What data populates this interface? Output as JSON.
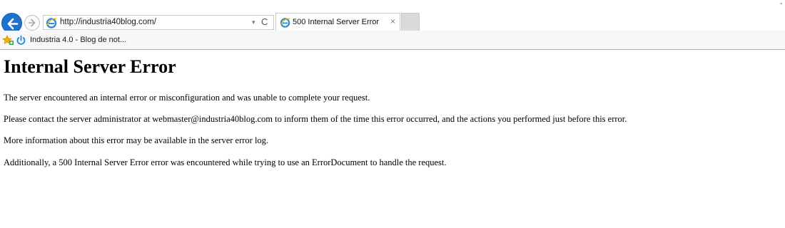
{
  "browser": {
    "address_bar": {
      "url": "http://industria40blog.com/"
    },
    "tab": {
      "title": "500 Internal Server Error",
      "close_glyph": "×"
    },
    "favorites_bar": {
      "item_label": "Industria 4.0 - Blog de not..."
    },
    "window_control_glyph": "-",
    "refresh_glyph": "C",
    "dropdown_glyph": "▾",
    "icons": [
      "back-arrow-icon",
      "forward-arrow-icon",
      "ie-logo-icon",
      "favorites-star-icon",
      "power-icon",
      "refresh-icon",
      "dropdown-arrow-icon",
      "close-icon"
    ],
    "colors": {
      "back_button": "#1f73cf",
      "ie_logo": "#2f8fd8",
      "favorites_star": "#f0b400"
    }
  },
  "page": {
    "heading": "Internal Server Error",
    "paragraphs": [
      "The server encountered an internal error or misconfiguration and was unable to complete your request.",
      "Please contact the server administrator at webmaster@industria40blog.com to inform them of the time this error occurred, and the actions you performed just before this error.",
      "More information about this error may be available in the server error log.",
      "Additionally, a 500 Internal Server Error error was encountered while trying to use an ErrorDocument to handle the request."
    ]
  }
}
